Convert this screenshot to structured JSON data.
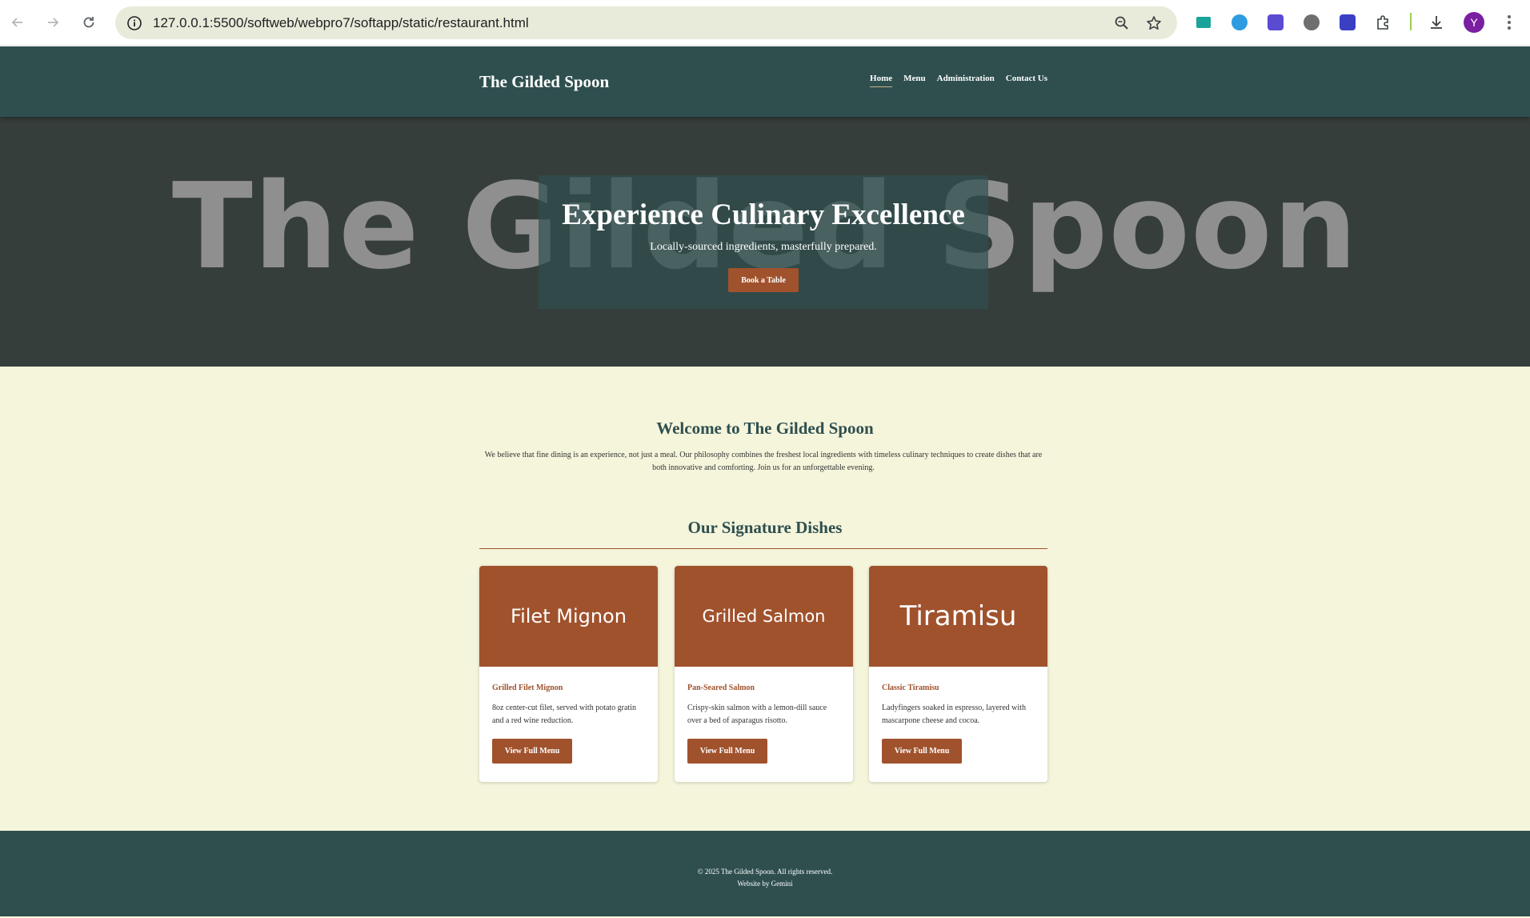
{
  "browser": {
    "url": "127.0.0.1:5500/softweb/webpro7/softapp/static/restaurant.html",
    "profile_initial": "Y",
    "icons": {
      "back": "arrow-left-icon",
      "forward": "arrow-right-icon",
      "reload": "reload-icon",
      "site_info": "info-icon",
      "zoom": "zoom-icon",
      "bookmark": "star-icon",
      "extensions": "puzzle-icon",
      "downloads": "download-icon",
      "menu": "more-vertical-icon"
    }
  },
  "site": {
    "brand": "The Gilded Spoon",
    "nav": [
      {
        "label": "Home",
        "active": true
      },
      {
        "label": "Menu",
        "active": false
      },
      {
        "label": "Administration",
        "active": false
      },
      {
        "label": "Contact Us",
        "active": false
      }
    ]
  },
  "hero": {
    "watermark": "The Gilded Spoon",
    "title": "Experience Culinary Excellence",
    "subtitle": "Locally-sourced ingredients, masterfully prepared.",
    "button": "Book a Table"
  },
  "welcome": {
    "title": "Welcome to The Gilded Spoon",
    "text": "We believe that fine dining is an experience, not just a meal. Our philosophy combines the freshest local ingredients with timeless culinary techniques to create dishes that are both innovative and comforting. Join us for an unforgettable evening."
  },
  "dishes": {
    "title": "Our Signature Dishes",
    "items": [
      {
        "image_label": "Filet Mignon",
        "name": "Grilled Filet Mignon",
        "description": "8oz center-cut filet, served with potato gratin and a red wine reduction.",
        "button": "View Full Menu"
      },
      {
        "image_label": "Grilled Salmon",
        "name": "Pan-Seared Salmon",
        "description": "Crispy-skin salmon with a lemon-dill sauce over a bed of asparagus risotto.",
        "button": "View Full Menu"
      },
      {
        "image_label": "Tiramisu",
        "name": "Classic Tiramisu",
        "description": "Ladyfingers soaked in espresso, layered with mascarpone cheese and cocoa.",
        "button": "View Full Menu"
      }
    ]
  },
  "footer": {
    "copyright": "© 2025 The Gilded Spoon. All rights reserved.",
    "credit": "Website by Gemini"
  },
  "colors": {
    "primary": "#2f4f4f",
    "accent": "#a0522d",
    "background": "#f5f5dc"
  }
}
